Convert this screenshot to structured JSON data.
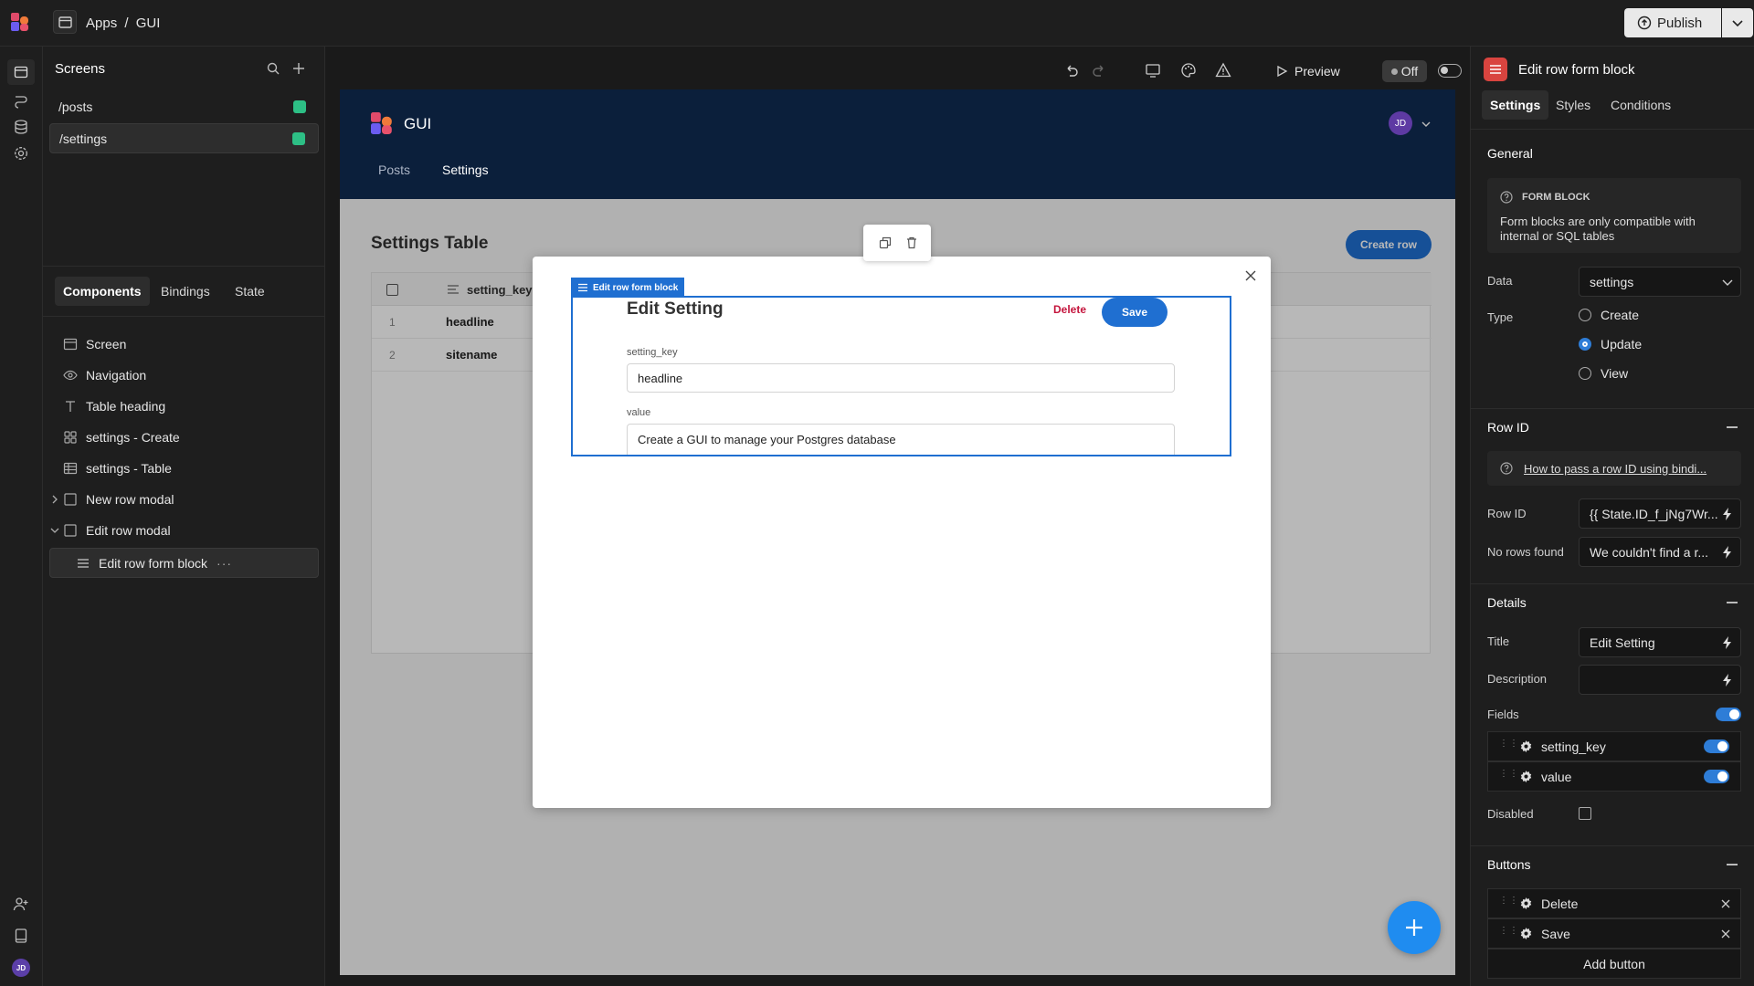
{
  "topbar": {
    "breadcrumb_apps": "Apps",
    "breadcrumb_sep": "/",
    "breadcrumb_app": "GUI",
    "publish_label": "Publish"
  },
  "screens": {
    "title": "Screens",
    "items": [
      {
        "path": "/posts"
      },
      {
        "path": "/settings"
      }
    ]
  },
  "components_tabs": [
    "Components",
    "Bindings",
    "State"
  ],
  "tree": [
    {
      "label": "Screen"
    },
    {
      "label": "Navigation"
    },
    {
      "label": "Table heading"
    },
    {
      "label": "settings - Create"
    },
    {
      "label": "settings - Table"
    },
    {
      "label": "New row modal"
    },
    {
      "label": "Edit row modal"
    },
    {
      "label": "Edit row form block"
    }
  ],
  "toolbar": {
    "preview_label": "Preview",
    "off_label": "Off"
  },
  "app": {
    "name": "GUI",
    "avatar": "JD",
    "nav": [
      "Posts",
      "Settings"
    ],
    "table_title": "Settings Table",
    "create_row": "Create row",
    "column": "setting_key",
    "rows": [
      {
        "n": "1",
        "key": "headline"
      },
      {
        "n": "2",
        "key": "sitename"
      }
    ]
  },
  "form": {
    "badge": "Edit row form block",
    "title": "Edit Setting",
    "delete": "Delete",
    "save": "Save",
    "field1_label": "setting_key",
    "field1_value": "headline",
    "field2_label": "value",
    "field2_value": "Create a GUI to manage your Postgres database"
  },
  "panel": {
    "title": "Edit row form block",
    "tabs": [
      "Settings",
      "Styles",
      "Conditions"
    ],
    "general": "General",
    "info_heading": "FORM BLOCK",
    "info_text_1": "Form blocks are only compatible with",
    "info_text_2": "internal or SQL tables",
    "data_label": "Data",
    "data_value": "settings",
    "type_label": "Type",
    "type_options": [
      "Create",
      "Update",
      "View"
    ],
    "rowid_section": "Row ID",
    "rowid_link": "How to pass a row ID using bindi...",
    "rowid_label": "Row ID",
    "rowid_value": "{{ State.ID_f_jNg7Wr...",
    "norows_label": "No rows found",
    "norows_value": "We couldn't find a r...",
    "details_section": "Details",
    "title_label": "Title",
    "title_value": "Edit Setting",
    "description_label": "Description",
    "fields_label": "Fields",
    "field_items": [
      "setting_key",
      "value"
    ],
    "disabled_label": "Disabled",
    "buttons_section": "Buttons",
    "button_items": [
      "Delete",
      "Save"
    ],
    "add_button": "Add button"
  },
  "rail": {
    "avatar": "JD"
  },
  "colors": {
    "accent": "#1f6fd1",
    "app_header": "#0b1f3b",
    "green": "#2dbf85",
    "danger": "#c4143c"
  }
}
